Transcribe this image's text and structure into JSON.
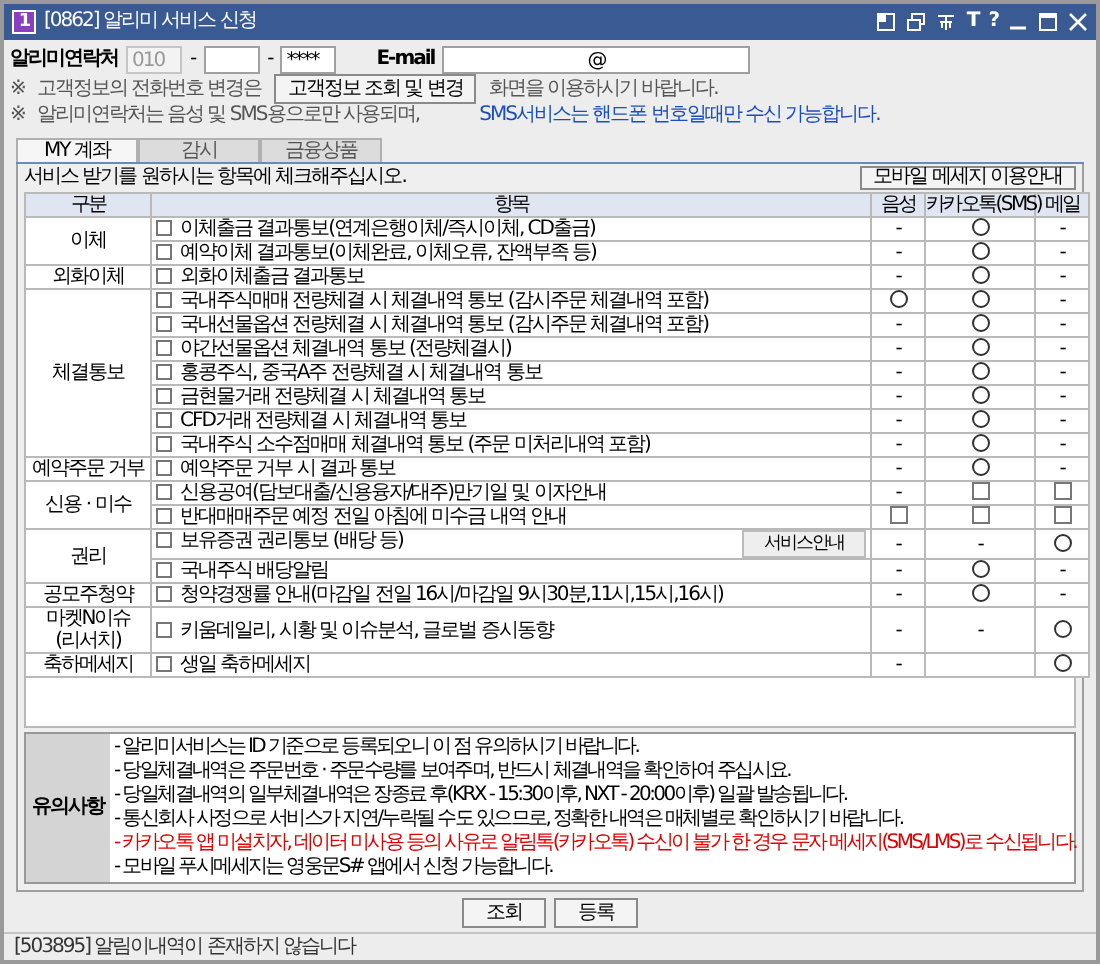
{
  "window": {
    "badge": "1",
    "title": "[0862] 알리미 서비스 신청",
    "tool_glyphs": [
      "T",
      "?"
    ]
  },
  "contact": {
    "label": "알리미연락처",
    "phone": [
      {
        "value": "010",
        "disabled": true
      },
      {
        "disabled": false
      },
      {
        "value": "****",
        "disabled": false
      }
    ],
    "separator": "-",
    "email_label": "E-mail",
    "email": "@"
  },
  "notes": [
    {
      "mark": "※",
      "text": "고객정보의 전화번호 변경은",
      "button": "고객정보 조회 및 변경",
      "after": "화면을 이용하시기 바랍니다."
    },
    {
      "mark": "※",
      "text": "알리미연락처는 음성 및 SMS용으로만 사용되며,",
      "after_blue": "SMS서비스는 핸드폰 번호일때만 수신 가능합니다."
    }
  ],
  "tabs": [
    {
      "label": "MY 계좌",
      "selected": true
    },
    {
      "label": "감시",
      "selected": false
    },
    {
      "label": "금융상품",
      "selected": false
    }
  ],
  "instruction": "서비스 받기를 원하시는 항목에 체크해주십시오.",
  "guide_button": "모바일 메세지 이용안내",
  "table": {
    "columns": [
      "구분",
      "항목",
      "음성",
      "카카오톡(SMS)",
      "메일"
    ],
    "groups": [
      {
        "label": "이체",
        "items": [
          {
            "label": "이체출금 결과통보(연계은행이체/즉시이체, CD출금)",
            "checked": false,
            "cells": [
              {
                "kind": "text",
                "text": "-"
              },
              {
                "kind": "circle"
              },
              {
                "kind": "text",
                "text": "-"
              }
            ]
          },
          {
            "label": "예약이체 결과통보(이체완료, 이체오류, 잔액부족 등)",
            "checked": false,
            "cells": [
              {
                "kind": "text",
                "text": "-"
              },
              {
                "kind": "circle"
              },
              {
                "kind": "text",
                "text": "-"
              }
            ]
          }
        ]
      },
      {
        "label": "외화이체",
        "items": [
          {
            "label": "외화이체출금 결과통보",
            "checked": false,
            "cells": [
              {
                "kind": "text",
                "text": "-"
              },
              {
                "kind": "circle"
              },
              {
                "kind": "text",
                "text": "-"
              }
            ]
          }
        ]
      },
      {
        "label": "체결통보",
        "items": [
          {
            "label": "국내주식매매 전량체결 시 체결내역 통보 (감시주문 체결내역 포함)",
            "checked": false,
            "cells": [
              {
                "kind": "circle"
              },
              {
                "kind": "circle"
              },
              {
                "kind": "text",
                "text": "-"
              }
            ]
          },
          {
            "label": "국내선물옵션 전량체결 시 체결내역 통보 (감시주문 체결내역 포함)",
            "checked": false,
            "cells": [
              {
                "kind": "text",
                "text": "-"
              },
              {
                "kind": "circle"
              },
              {
                "kind": "text",
                "text": "-"
              }
            ]
          },
          {
            "label": "야간선물옵션 체결내역 통보 (전량체결시)",
            "checked": false,
            "cells": [
              {
                "kind": "text",
                "text": "-"
              },
              {
                "kind": "circle"
              },
              {
                "kind": "text",
                "text": "-"
              }
            ]
          },
          {
            "label": "홍콩주식, 중국A주 전량체결 시 체결내역 통보",
            "checked": false,
            "cells": [
              {
                "kind": "text",
                "text": "-"
              },
              {
                "kind": "circle"
              },
              {
                "kind": "text",
                "text": "-"
              }
            ]
          },
          {
            "label": "금현물거래 전량체결 시 체결내역 통보",
            "checked": false,
            "cells": [
              {
                "kind": "text",
                "text": "-"
              },
              {
                "kind": "circle"
              },
              {
                "kind": "text",
                "text": "-"
              }
            ]
          },
          {
            "label": "CFD거래 전량체결 시 체결내역 통보",
            "checked": false,
            "cells": [
              {
                "kind": "text",
                "text": "-"
              },
              {
                "kind": "circle"
              },
              {
                "kind": "text",
                "text": "-"
              }
            ]
          },
          {
            "label": "국내주식 소수점매매 체결내역 통보 (주문 미처리내역 포함)",
            "checked": false,
            "cells": [
              {
                "kind": "text",
                "text": "-"
              },
              {
                "kind": "circle"
              },
              {
                "kind": "text",
                "text": "-"
              }
            ]
          }
        ]
      },
      {
        "label": "예약주문 거부",
        "items": [
          {
            "label": "예약주문 거부 시 결과 통보",
            "checked": false,
            "cells": [
              {
                "kind": "text",
                "text": "-"
              },
              {
                "kind": "circle"
              },
              {
                "kind": "text",
                "text": "-"
              }
            ]
          }
        ]
      },
      {
        "label": "신용 · 미수",
        "items": [
          {
            "label": "신용공여(담보대출/신용융자/대주)만기일 및 이자안내",
            "checked": false,
            "cells": [
              {
                "kind": "text",
                "text": "-"
              },
              {
                "kind": "checkbox",
                "checked": false
              },
              {
                "kind": "checkbox",
                "checked": false
              }
            ]
          },
          {
            "label": "반대매매주문 예정 전일 아침에 미수금 내역 안내",
            "checked": false,
            "cells": [
              {
                "kind": "checkbox",
                "checked": false
              },
              {
                "kind": "checkbox",
                "checked": false
              },
              {
                "kind": "checkbox",
                "checked": false
              }
            ]
          }
        ]
      },
      {
        "label": "권리",
        "items": [
          {
            "label": "보유증권 권리통보 (배당 등)",
            "checked": false,
            "button": "서비스안내",
            "cells": [
              {
                "kind": "text",
                "text": "-"
              },
              {
                "kind": "text",
                "text": "-"
              },
              {
                "kind": "circle"
              }
            ]
          },
          {
            "label": "국내주식 배당알림",
            "checked": false,
            "cells": [
              {
                "kind": "text",
                "text": "-"
              },
              {
                "kind": "circle"
              },
              {
                "kind": "text",
                "text": "-"
              }
            ]
          }
        ]
      },
      {
        "label": "공모주청약",
        "items": [
          {
            "label": "청약경쟁률 안내(마감일 전일 16시/마감일 9시30분,11시,15시,16시)",
            "checked": false,
            "cells": [
              {
                "kind": "text",
                "text": "-"
              },
              {
                "kind": "circle"
              },
              {
                "kind": "text",
                "text": "-"
              }
            ]
          }
        ]
      },
      {
        "label": "마켓N이슈\n(리서치)",
        "items": [
          {
            "label": "키움데일리, 시황 및 이슈분석, 글로벌 증시동향",
            "checked": false,
            "cells": [
              {
                "kind": "text",
                "text": "-"
              },
              {
                "kind": "text",
                "text": "-"
              },
              {
                "kind": "circle"
              }
            ]
          }
        ]
      },
      {
        "label": "축하메세지",
        "items": [
          {
            "label": "생일 축하메세지",
            "checked": false,
            "cells": [
              {
                "kind": "text",
                "text": "-"
              },
              null,
              {
                "kind": "circle"
              }
            ]
          }
        ]
      }
    ]
  },
  "notice": {
    "label": "유의사항",
    "lines": [
      {
        "text": "- 알리미서비스는 ID 기준으로 등록되오니 이 점 유의하시기 바랍니다.",
        "warning": false
      },
      {
        "text": "- 당일체결내역은 주문번호 · 주문수량를 보여주며, 반드시 체결내역을 확인하여 주십시요.",
        "warning": false
      },
      {
        "text": "- 당일체결내역의 일부체결내역은 장종료 후(KRX - 15:30이후, NXT - 20:00이후) 일괄 발송됩니다.",
        "warning": false
      },
      {
        "text": "- 통신회사 사정으로 서비스가 지연/누락될 수도 있으므로, 정확한 내역은 매체별로 확인하시기 바랍니다.",
        "warning": false
      },
      {
        "text": "- 카카오톡 앱 미설치자, 데이터 미사용 등의 사유로 알림톡(카카오톡) 수신이 불가 한 경우 문자 메세지(SMS/LMS)로 수신됩니다.",
        "warning": true
      },
      {
        "text": "- 모바일 푸시메세지는 영웅문S# 앱에서 신청 가능합니다.",
        "warning": false
      }
    ]
  },
  "buttons": [
    "조회",
    "등록"
  ],
  "status_bar": "[503895] 알림이내역이 존재하지 않습니다"
}
